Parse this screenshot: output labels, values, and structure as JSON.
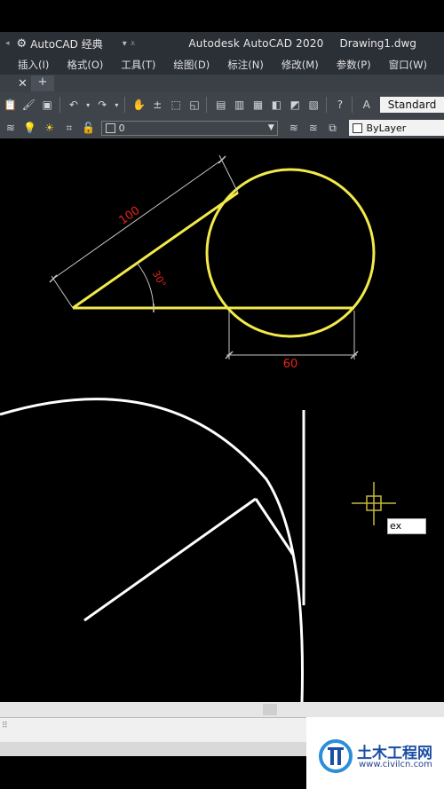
{
  "titlebar": {
    "workspace": "AutoCAD 经典",
    "app_title": "Autodesk AutoCAD 2020",
    "document": "Drawing1.dwg"
  },
  "menubar": {
    "items": [
      "插入(I)",
      "格式(O)",
      "工具(T)",
      "绘图(D)",
      "标注(N)",
      "修改(M)",
      "参数(P)",
      "窗口(W)"
    ]
  },
  "toolbar": {
    "text_style": "Standard",
    "layer": "0",
    "color": "ByLayer"
  },
  "drawing": {
    "dim_length": "100",
    "dim_angle": "30°",
    "dim_diameter": "60",
    "colors": {
      "yellow": "#f2ea4a",
      "white": "#ffffff",
      "dim_text": "#e8241a",
      "dim_line": "#c8c8c8"
    }
  },
  "command": {
    "input_value": "ex"
  },
  "watermark": {
    "text": "土木工程网",
    "url": "www.civilcn.com"
  }
}
